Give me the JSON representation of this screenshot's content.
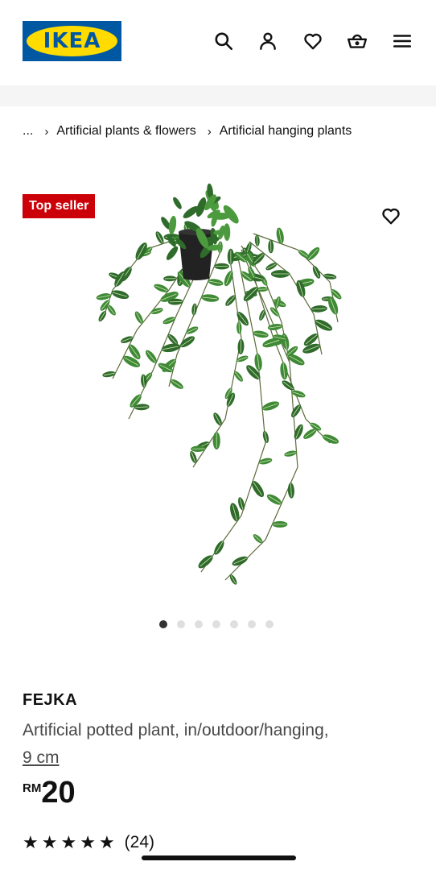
{
  "header": {
    "logo_text": "IKEA",
    "brand_colors": {
      "blue": "#0058a3",
      "yellow": "#ffdb00"
    },
    "icons": [
      "search-icon",
      "account-icon",
      "favourites-icon",
      "basket-icon",
      "menu-icon"
    ]
  },
  "breadcrumb": {
    "ellipsis": "...",
    "items": [
      "Artificial plants & flowers",
      "Artificial hanging plants"
    ]
  },
  "product": {
    "badge": "Top seller",
    "badge_color": "#cc0008",
    "name": "FEJKA",
    "description": "Artificial potted plant, in/outdoor/hanging,",
    "size": "9 cm",
    "currency": "RM",
    "price": "20",
    "rating": {
      "stars": 5,
      "count": "(24)"
    },
    "gallery": {
      "total": 7,
      "active": 1
    }
  }
}
